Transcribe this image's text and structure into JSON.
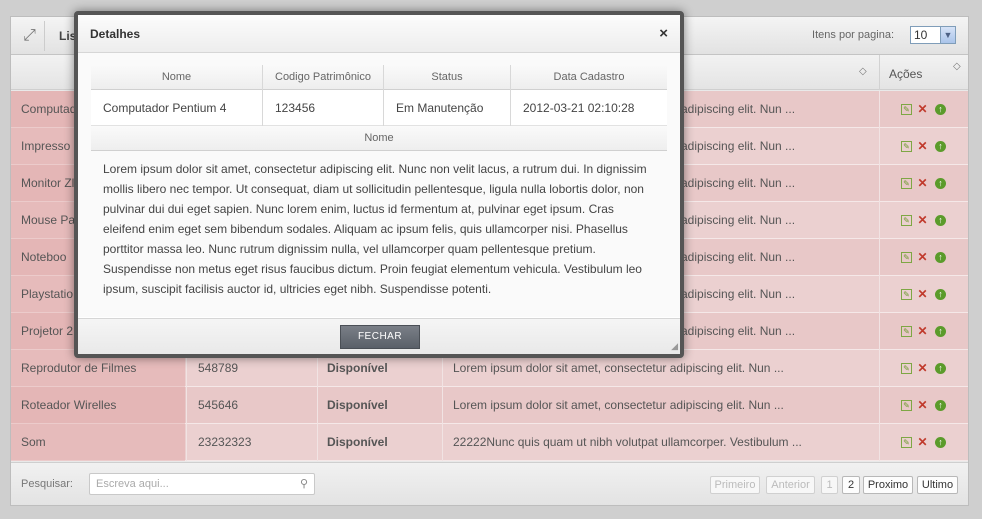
{
  "background": {
    "title": "Lis",
    "per_page_label": "Itens por pagina:",
    "per_page_value": "10",
    "actions_header": "Ações",
    "rows": [
      {
        "name": "Computad",
        "code": "",
        "status": "",
        "desc": "adipiscing elit. Nun ..."
      },
      {
        "name": "Impresso",
        "code": "",
        "status": "",
        "desc": "adipiscing elit. Nun ..."
      },
      {
        "name": "Monitor Zl",
        "code": "",
        "status": "",
        "desc": "adipiscing elit. Nun ..."
      },
      {
        "name": "Mouse Pa",
        "code": "",
        "status": "",
        "desc": "adipiscing elit. Nun ..."
      },
      {
        "name": "Noteboo",
        "code": "",
        "status": "",
        "desc": "adipiscing elit. Nun ..."
      },
      {
        "name": "Playstatio",
        "code": "",
        "status": "",
        "desc": "adipiscing elit. Nun ..."
      },
      {
        "name": "Projetor 2",
        "code": "",
        "status": "",
        "desc": "adipiscing elit. Nun ..."
      },
      {
        "name": "Reprodutor de Filmes",
        "code": "548789",
        "status": "Disponível",
        "desc": "Lorem ipsum dolor sit amet, consectetur adipiscing elit. Nun ..."
      },
      {
        "name": "Roteador Wirelles",
        "code": "545646",
        "status": "Disponível",
        "desc": "Lorem ipsum dolor sit amet, consectetur adipiscing elit. Nun ..."
      },
      {
        "name": "Som",
        "code": "23232323",
        "status": "Disponível",
        "desc": "22222Nunc quis quam ut nibh volutpat ullamcorper. Vestibulum ..."
      }
    ],
    "search_label": "Pesquisar:",
    "search_placeholder": "Escreva aqui...",
    "pagination": {
      "first": "Primeiro",
      "prev": "Anterior",
      "p1": "1",
      "p2": "2",
      "next": "Proximo",
      "last": "Ultimo"
    }
  },
  "modal": {
    "title": "Detalhes",
    "close": "×",
    "columns": [
      "Nome",
      "Codigo Patrimônico",
      "Status",
      "Data Cadastro"
    ],
    "row": {
      "nome": "Computador Pentium 4",
      "codigo": "123456",
      "status": "Em Manutenção",
      "data": "2012-03-21 02:10:28"
    },
    "desc_header": "Nome",
    "description": "Lorem ipsum dolor sit amet, consectetur adipiscing elit. Nunc non velit lacus, a rutrum dui. In dignissim mollis libero nec tempor. Ut consequat, diam ut sollicitudin pellentesque, ligula nulla lobortis dolor, non pulvinar dui dui eget sapien. Nunc lorem enim, luctus id fermentum at, pulvinar eget ipsum. Cras eleifend enim eget sem bibendum sodales. Aliquam ac ipsum felis, quis ullamcorper nisi. Phasellus porttitor massa leo. Nunc rutrum dignissim nulla, vel ullamcorper quam pellentesque pretium. Suspendisse non metus eget risus faucibus dictum. Proin feugiat elementum vehicula. Vestibulum leo ipsum, suscipit facilisis auctor id, ultricies eget nibh. Suspendisse potenti.",
    "close_button": "FECHAR"
  }
}
